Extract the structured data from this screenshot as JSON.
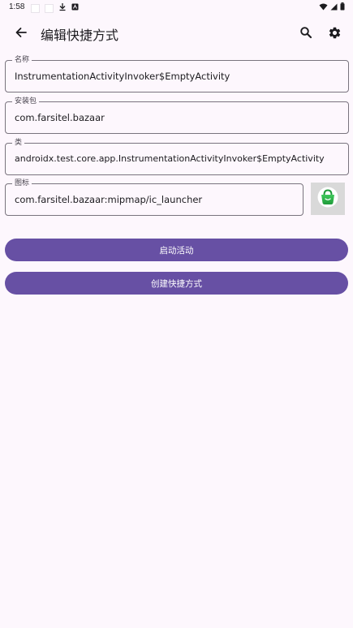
{
  "status_bar": {
    "time": "1:58"
  },
  "app_bar": {
    "title": "编辑快捷方式"
  },
  "fields": {
    "name": {
      "label": "名称",
      "value": "InstrumentationActivityInvoker$EmptyActivity"
    },
    "package": {
      "label": "安装包",
      "value": "com.farsitel.bazaar"
    },
    "class": {
      "label": "类",
      "value": "androidx.test.core.app.InstrumentationActivityInvoker$EmptyActivity"
    },
    "icon": {
      "label": "图标",
      "value": "com.farsitel.bazaar:mipmap/ic_launcher"
    }
  },
  "buttons": {
    "launch_label": "启动活动",
    "create_label": "创建快捷方式"
  },
  "colors": {
    "background": "#fdf7fd",
    "primary": "#6750a4",
    "outline": "#79747e",
    "icon_green": "#2db34a"
  },
  "icons": {
    "back": "arrow-left-icon",
    "search": "search-icon",
    "settings": "gear-icon",
    "app": "shopping-bag-icon"
  }
}
